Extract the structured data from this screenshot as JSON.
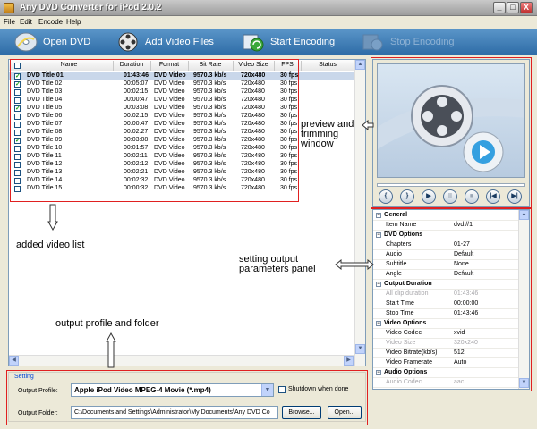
{
  "window": {
    "title": "Any DVD Converter for iPod 2.0.2",
    "minimize": "_",
    "maximize": "□",
    "close": "X"
  },
  "menu": [
    "File",
    "Edit",
    "Encode",
    "Help"
  ],
  "toolbar": {
    "open_dvd": "Open DVD",
    "add_video": "Add Video Files",
    "start_encoding": "Start Encoding",
    "stop_encoding": "Stop Encoding"
  },
  "list": {
    "columns": [
      "Name",
      "Duration",
      "Format",
      "Bit Rate",
      "Video Size",
      "FPS",
      "Status"
    ],
    "rows": [
      {
        "name": "DVD Title 01",
        "duration": "01:43:46",
        "format": "DVD Video",
        "bitrate": "9570.3 kb/s",
        "size": "720x480",
        "fps": "30 fps",
        "status": "",
        "checked": true,
        "selected": true
      },
      {
        "name": "DVD Title 02",
        "duration": "00:05:07",
        "format": "DVD Video",
        "bitrate": "9570.3 kb/s",
        "size": "720x480",
        "fps": "30 fps",
        "status": "",
        "checked": true
      },
      {
        "name": "DVD Title 03",
        "duration": "00:02:15",
        "format": "DVD Video",
        "bitrate": "9570.3 kb/s",
        "size": "720x480",
        "fps": "30 fps",
        "status": "",
        "checked": false
      },
      {
        "name": "DVD Title 04",
        "duration": "00:00:47",
        "format": "DVD Video",
        "bitrate": "9570.3 kb/s",
        "size": "720x480",
        "fps": "30 fps",
        "status": "",
        "checked": false
      },
      {
        "name": "DVD Title 05",
        "duration": "00:03:08",
        "format": "DVD Video",
        "bitrate": "9570.3 kb/s",
        "size": "720x480",
        "fps": "30 fps",
        "status": "",
        "checked": true
      },
      {
        "name": "DVD Title 06",
        "duration": "00:02:15",
        "format": "DVD Video",
        "bitrate": "9570.3 kb/s",
        "size": "720x480",
        "fps": "30 fps",
        "status": "",
        "checked": false
      },
      {
        "name": "DVD Title 07",
        "duration": "00:00:47",
        "format": "DVD Video",
        "bitrate": "9570.3 kb/s",
        "size": "720x480",
        "fps": "30 fps",
        "status": "",
        "checked": false
      },
      {
        "name": "DVD Title 08",
        "duration": "00:02:27",
        "format": "DVD Video",
        "bitrate": "9570.3 kb/s",
        "size": "720x480",
        "fps": "30 fps",
        "status": "",
        "checked": false
      },
      {
        "name": "DVD Title 09",
        "duration": "00:03:08",
        "format": "DVD Video",
        "bitrate": "9570.3 kb/s",
        "size": "720x480",
        "fps": "30 fps",
        "status": "",
        "checked": true
      },
      {
        "name": "DVD Title 10",
        "duration": "00:01:57",
        "format": "DVD Video",
        "bitrate": "9570.3 kb/s",
        "size": "720x480",
        "fps": "30 fps",
        "status": "",
        "checked": false
      },
      {
        "name": "DVD Title 11",
        "duration": "00:02:11",
        "format": "DVD Video",
        "bitrate": "9570.3 kb/s",
        "size": "720x480",
        "fps": "30 fps",
        "status": "",
        "checked": false
      },
      {
        "name": "DVD Title 12",
        "duration": "00:02:12",
        "format": "DVD Video",
        "bitrate": "9570.3 kb/s",
        "size": "720x480",
        "fps": "30 fps",
        "status": "",
        "checked": false
      },
      {
        "name": "DVD Title 13",
        "duration": "00:02:21",
        "format": "DVD Video",
        "bitrate": "9570.3 kb/s",
        "size": "720x480",
        "fps": "30 fps",
        "status": "",
        "checked": false
      },
      {
        "name": "DVD Title 14",
        "duration": "00:02:32",
        "format": "DVD Video",
        "bitrate": "9570.3 kb/s",
        "size": "720x480",
        "fps": "30 fps",
        "status": "",
        "checked": false
      },
      {
        "name": "DVD Title 15",
        "duration": "00:00:32",
        "format": "DVD Video",
        "bitrate": "9570.3 kb/s",
        "size": "720x480",
        "fps": "30 fps",
        "status": "",
        "checked": false
      }
    ]
  },
  "preview": {
    "controls": [
      "{",
      "}",
      "▶",
      "II",
      "■",
      "|◀",
      "▶|"
    ]
  },
  "properties": [
    {
      "group": "General"
    },
    {
      "key": "Item Name",
      "value": "dvd://1"
    },
    {
      "group": "DVD Options"
    },
    {
      "key": "Chapters",
      "value": "01-27"
    },
    {
      "key": "Audio",
      "value": "Default"
    },
    {
      "key": "Subtitle",
      "value": "None"
    },
    {
      "key": "Angle",
      "value": "Default"
    },
    {
      "group": "Output Duration"
    },
    {
      "key": "All clip duration",
      "value": "01:43:46",
      "disabled": true
    },
    {
      "key": "Start Time",
      "value": "00:00:00"
    },
    {
      "key": "Stop Time",
      "value": "01:43:46"
    },
    {
      "group": "Video Options"
    },
    {
      "key": "Video Codec",
      "value": "xvid"
    },
    {
      "key": "Video Size",
      "value": "320x240",
      "disabled": true
    },
    {
      "key": "Video Bitrate(kb/s)",
      "value": "512"
    },
    {
      "key": "Video Framerate",
      "value": "Auto"
    },
    {
      "group": "Audio Options"
    },
    {
      "key": "Audio Codec",
      "value": "aac",
      "disabled": true
    }
  ],
  "settings": {
    "legend": "Setting",
    "profile_label": "Output Profile:",
    "profile_value": "Apple iPod Video MPEG-4 Movie (*.mp4)",
    "shutdown_label": "Shutdown when done",
    "folder_label": "Output Folder:",
    "folder_value": "C:\\Documents and Settings\\Administrator\\My Documents\\Any DVD Co",
    "browse": "Browse...",
    "open": "Open..."
  },
  "annotations": {
    "preview": "preview and\ntrimming\nwindow",
    "list": "added video list",
    "params": "setting output\nparameters panel",
    "profile": "output profile and folder"
  },
  "colors": {
    "toolbar": "#2d6ba6",
    "selection": "#c9d7ea",
    "highlight_box": "#e02020"
  }
}
